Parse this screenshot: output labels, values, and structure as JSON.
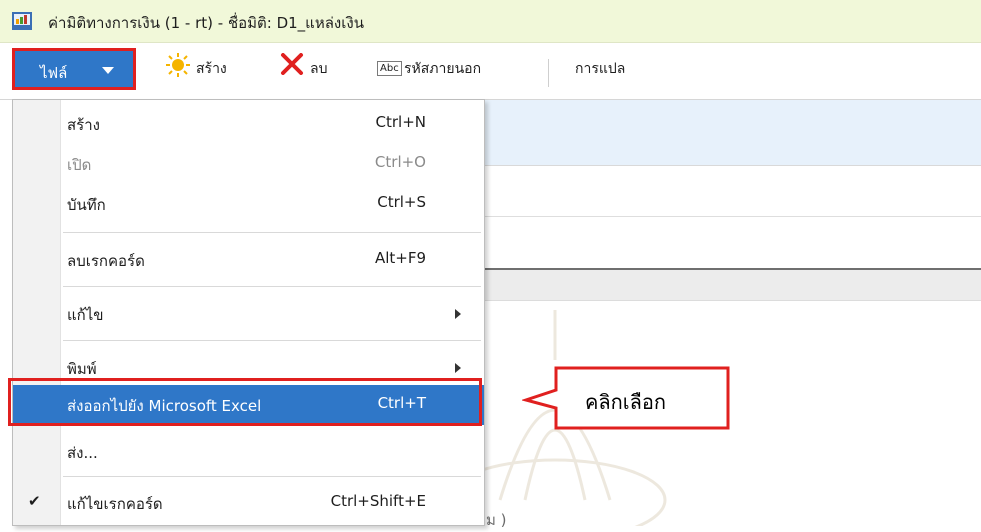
{
  "window": {
    "title": "ค่ามิติทางการเงิน (1 - rt) - ชื่อมิติ: D1_แหล่งเงิน",
    "app_icon": "dynamics-app-icon"
  },
  "toolbar": {
    "file_label": "ไฟล์",
    "new_label": "สร้าง",
    "delete_label": "ลบ",
    "external_code_label": "รหัสภายนอก",
    "translation_label": "การแปล",
    "abc_icon_text": "Abc"
  },
  "menu": {
    "items": [
      {
        "label": "สร้าง",
        "shortcut": "Ctrl+N",
        "disabled": false
      },
      {
        "label": "เปิด",
        "shortcut": "Ctrl+O",
        "disabled": true
      },
      {
        "label": "บันทึก",
        "shortcut": "Ctrl+S",
        "disabled": false
      },
      {
        "label": "ลบเรกคอร์ด",
        "shortcut": "Alt+F9",
        "disabled": false
      },
      {
        "label": "แก้ไข",
        "shortcut": "",
        "submenu": true
      },
      {
        "label": "พิมพ์",
        "shortcut": "",
        "submenu": true
      },
      {
        "label": "ส่งออกไปยัง Microsoft Excel",
        "shortcut": "Ctrl+T",
        "highlighted": true
      },
      {
        "label": "ส่ง...",
        "shortcut": ""
      },
      {
        "label": "แก้ไขเรกคอร์ด",
        "shortcut": "Ctrl+Shift+E",
        "checked": true
      }
    ]
  },
  "callout": {
    "text": "คลิกเลือก"
  },
  "background": {
    "fragment": "ม )"
  },
  "colors": {
    "title_bg": "#f1f8d9",
    "file_button_bg": "#2f77c8",
    "highlight_bg": "#2f77c8",
    "annotation_red": "#e0201f",
    "band_bg": "#e7f1fb"
  }
}
